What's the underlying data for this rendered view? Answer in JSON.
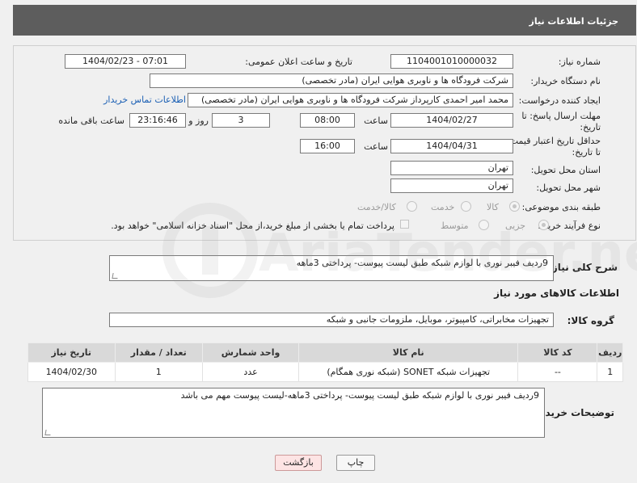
{
  "header": {
    "title": "جزئیات اطلاعات نیاز"
  },
  "form": {
    "need_number_label": "شماره نیاز:",
    "need_number": "1104001010000032",
    "announce_label": "تاریخ و ساعت اعلان عمومی:",
    "announce_value": "1404/02/23 - 07:01",
    "buyer_org_label": "نام دستگاه خریدار:",
    "buyer_org": "شرکت فرودگاه ها و ناوبری هوایی ایران (مادر تخصصی)",
    "creator_label": "ایجاد کننده درخواست:",
    "creator": "محمد امیر احمدی کارپرداز شرکت فرودگاه ها و ناوبری هوایی ایران (مادر تخصصی)",
    "contact_link": "اطلاعات تماس خریدار",
    "deadline_label_1": "مهلت ارسال پاسخ: تا",
    "deadline_label_2": "تاریخ:",
    "deadline_date": "1404/02/27",
    "time_label": "ساعت",
    "deadline_time": "08:00",
    "days_value": "3",
    "days_label": "روز و",
    "remaining_time": "23:16:46",
    "remaining_label": "ساعت باقی مانده",
    "validity_label_1": "حداقل تاریخ اعتبار قیمت:",
    "validity_label_2": "تا تاریخ:",
    "validity_date": "1404/04/31",
    "validity_time": "16:00",
    "province_label": "استان محل تحویل:",
    "province": "تهران",
    "city_label": "شهر محل تحویل:",
    "city": "تهران",
    "category_label": "طبقه بندی موضوعی:",
    "category_options": [
      "کالا",
      "خدمت",
      "کالا/خدمت"
    ],
    "process_label": "نوع فرآیند خرید :",
    "process_options": [
      "جزیی",
      "متوسط"
    ],
    "payment_note": "پرداخت تمام یا بخشی از مبلغ خرید،از محل \"اسناد خزانه اسلامی\" خواهد بود."
  },
  "summary": {
    "label": "شرح کلی نیاز:",
    "text": "9ردیف فیبر نوری با لوازم شبکه طبق لیست پیوست- پرداختی 3ماهه"
  },
  "goods": {
    "section_title": "اطلاعات کالاهای مورد نیاز",
    "group_label": "گروه کالا:",
    "group_value": "تجهیزات مخابراتی، کامپیوتر، موبایل، ملزومات جانبی و شبکه"
  },
  "table": {
    "headers": [
      "ردیف",
      "کد کالا",
      "نام کالا",
      "واحد شمارش",
      "تعداد / مقدار",
      "تاریخ نیاز"
    ],
    "rows": [
      [
        "1",
        "--",
        "تجهیزات شبکه SONET (شبکه نوری همگام)",
        "عدد",
        "1",
        "1404/02/30"
      ]
    ]
  },
  "buyer_notes": {
    "label": "توضیحات خریدار:",
    "text": "9ردیف فیبر نوری با لوازم شبکه طبق لیست پیوست- پرداختی 3ماهه-لیست پیوست مهم می باشد"
  },
  "buttons": {
    "print": "چاپ",
    "back": "بازگشت"
  },
  "watermark": {
    "text": "AriaTender.neT"
  }
}
